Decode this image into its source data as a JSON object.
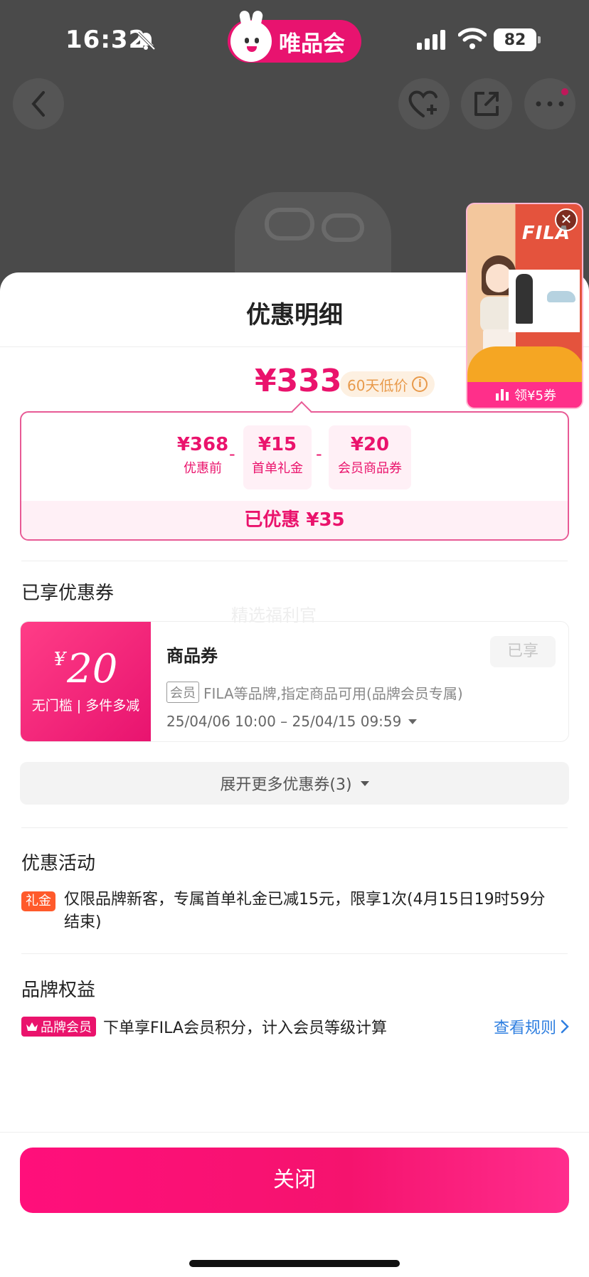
{
  "status_bar": {
    "time": "16:32",
    "battery": "82",
    "app_name": "唯品会"
  },
  "icons": {
    "bell": "bell-muted-icon",
    "signal": "signal-icon",
    "wifi": "wifi-icon",
    "back": "chevron-left-icon",
    "favorite": "heart-plus-icon",
    "share": "share-icon",
    "more": "more-dots-icon"
  },
  "float_ad": {
    "brand": "FILA",
    "cta": "领¥5券"
  },
  "sheet": {
    "title": "优惠明细",
    "final_price": "¥333",
    "low_price_tag": "60天低价",
    "breakdown": {
      "items": [
        {
          "amount": "¥368",
          "label": "优惠前"
        },
        {
          "amount": "¥15",
          "label": "首单礼金"
        },
        {
          "amount": "¥20",
          "label": "会员商品券"
        }
      ],
      "operator": "-",
      "total": "已优惠 ¥35"
    },
    "coupons_section": {
      "title": "已享优惠券",
      "watermark": "精选福利官",
      "coupon": {
        "currency": "¥",
        "amount": "20",
        "condition": "无门槛 | 多件多减",
        "name": "商品券",
        "status": "已享",
        "member_chip": "会员",
        "description": "FILA等品牌,指定商品可用(品牌会员专属)",
        "validity": "25/04/06 10:00 – 25/04/15 09:59"
      },
      "expand_label": "展开更多优惠券(3)"
    },
    "activities_section": {
      "title": "优惠活动",
      "tag": "礼金",
      "text": "仅限品牌新客，专属首单礼金已减15元，限享1次(4月15日19时59分结束)"
    },
    "brand_section": {
      "title": "品牌权益",
      "tag": "品牌会员",
      "text": "下单享FILA会员积分，计入会员等级计算",
      "link": "查看规则"
    },
    "close_label": "关闭"
  },
  "colors": {
    "brand_pink": "#ea136c",
    "link_blue": "#2f7fe0",
    "gift_orange": "#ff5a2b"
  }
}
